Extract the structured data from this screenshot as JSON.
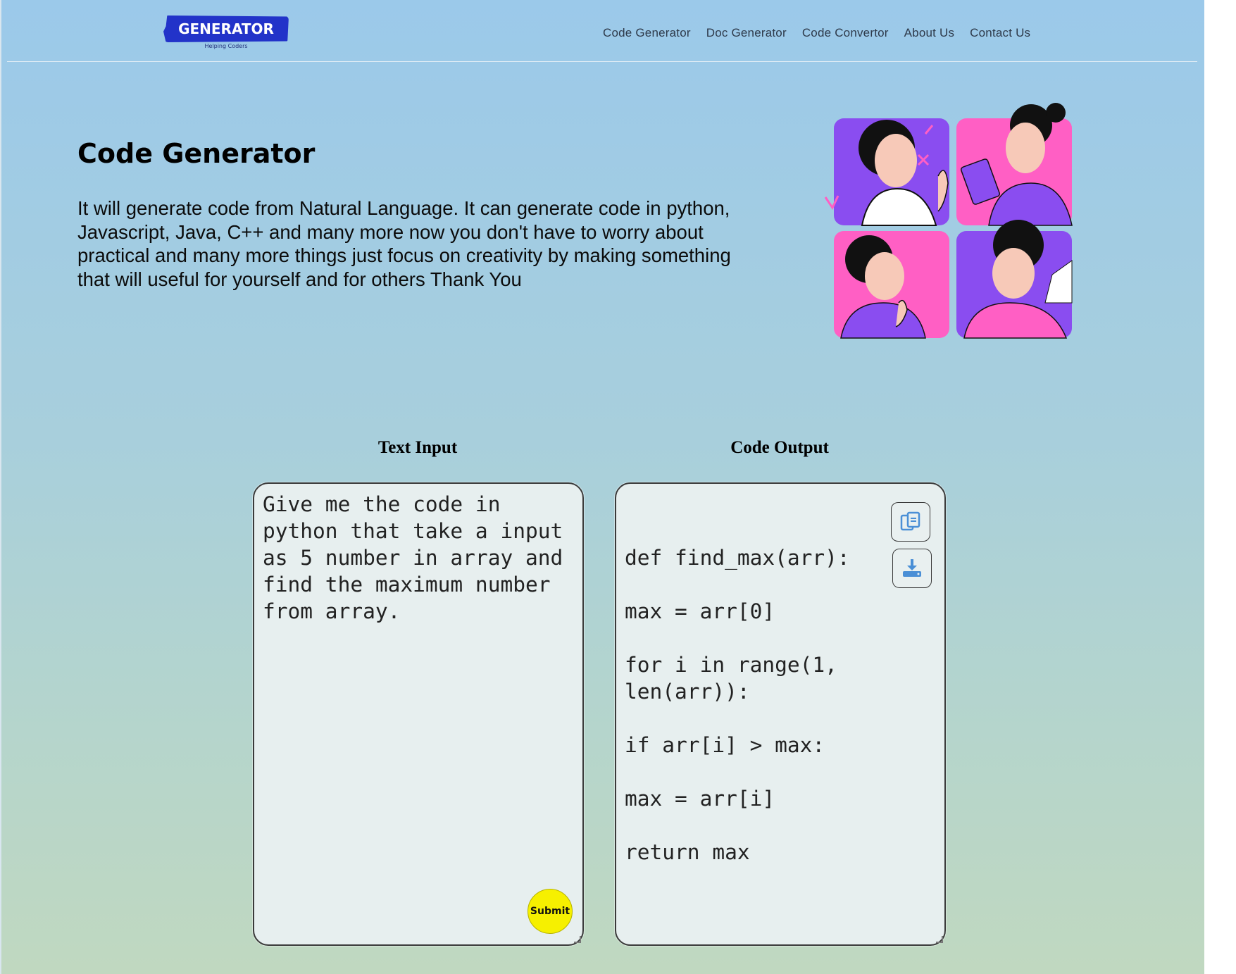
{
  "header": {
    "logo_title": "GENERATOR",
    "logo_tagline": "Helping Coders",
    "nav": [
      {
        "label": "Code Generator"
      },
      {
        "label": "Doc Generator"
      },
      {
        "label": "Code Convertor"
      },
      {
        "label": "About Us"
      },
      {
        "label": "Contact Us"
      }
    ]
  },
  "hero": {
    "title": "Code Generator",
    "description": "It will generate code from Natural Language. It can generate code in python, Javascript, Java, C++ and many more now you don't have to worry about practical and many more things just focus on creativity by making something that will useful for yourself and for others Thank You"
  },
  "input_panel": {
    "label": "Text Input",
    "value": "Give me the code in python that take a input as 5 number in array and find the maximum number from array.",
    "submit_label": "Submit"
  },
  "output_panel": {
    "label": "Code Output",
    "lines": [
      "def find_max(arr):",
      "max = arr[0]",
      "for i in range(1, len(arr)):",
      "if arr[i] > max:",
      "max = arr[i]",
      "return max"
    ],
    "copy_icon": "copy-icon",
    "download_icon": "download-icon"
  },
  "colors": {
    "logo_blue": "#2233c9",
    "submit_yellow": "#f6f000",
    "accent_purple": "#8a4df0",
    "accent_pink": "#ff5fc4"
  }
}
